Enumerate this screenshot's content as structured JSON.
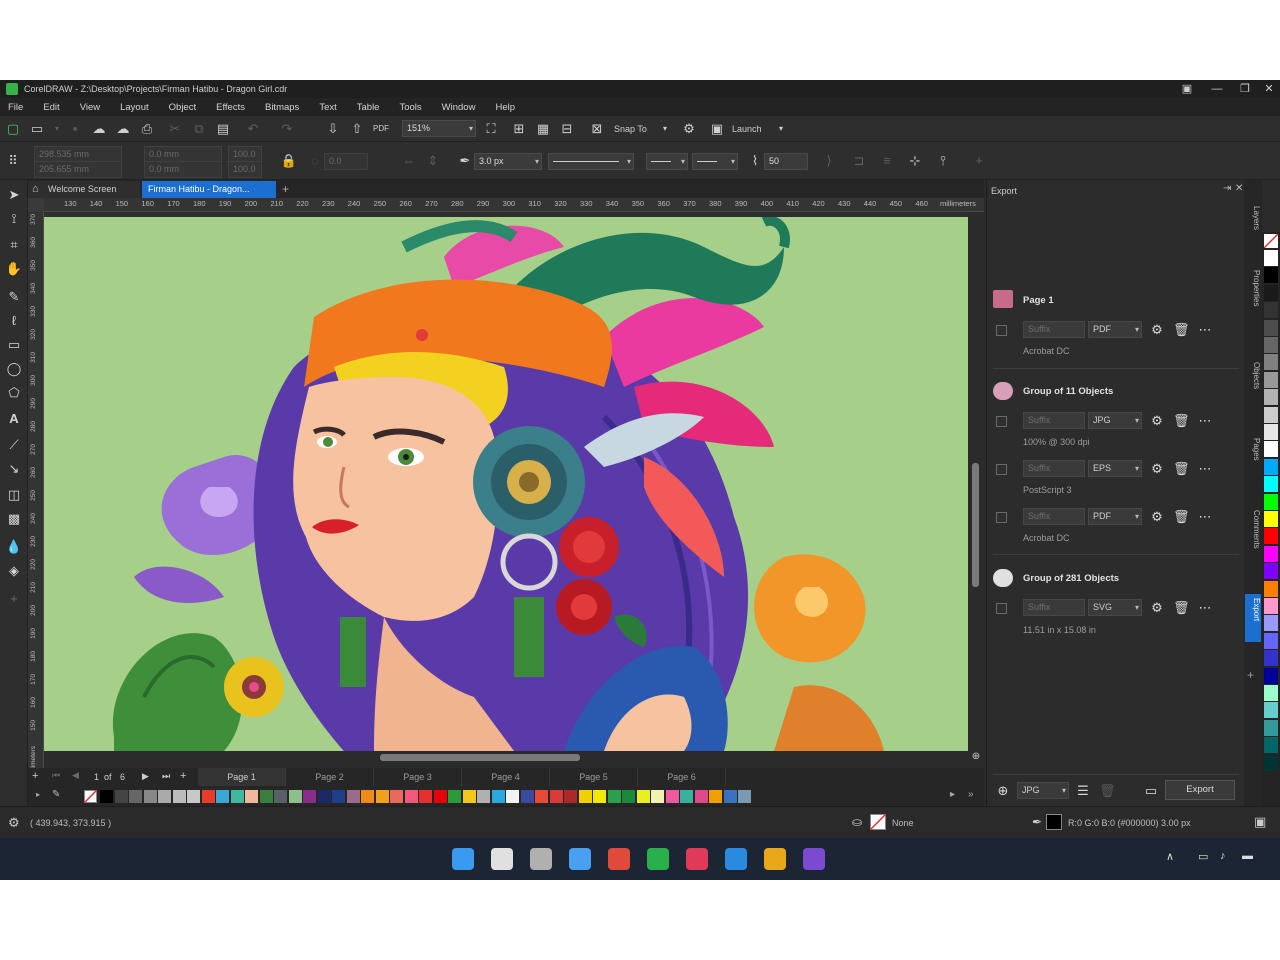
{
  "window": {
    "title": "CorelDRAW - Z:\\Desktop\\Projects\\Firman Hatibu - Dragon Girl.cdr",
    "min_icon": "minimize-icon",
    "max_icon": "restore-icon",
    "close_icon": "close-icon"
  },
  "menu": [
    "File",
    "Edit",
    "View",
    "Layout",
    "Object",
    "Effects",
    "Bitmaps",
    "Text",
    "Table",
    "Tools",
    "Window",
    "Help"
  ],
  "toolbar": {
    "zoom": "151%",
    "snap_to": "Snap To",
    "launch": "Launch"
  },
  "property_bar": {
    "x": "298.535 mm",
    "y": "205.655 mm",
    "w": "0.0 mm",
    "h": "0.0 mm",
    "scale_x": "100.0",
    "scale_y": "100.0",
    "angle": "0.0",
    "angle_pct": "50",
    "outline_width": "3.0 px",
    "smoothing": "50"
  },
  "doc_tabs": {
    "welcome": "Welcome Screen",
    "document": "Firman Hatibu - Dragon..."
  },
  "ruler": {
    "ticks": [
      "130",
      "140",
      "150",
      "160",
      "170",
      "180",
      "190",
      "200",
      "210",
      "220",
      "230",
      "240",
      "250",
      "260",
      "270",
      "280",
      "290",
      "300",
      "310",
      "320",
      "330",
      "340",
      "350",
      "360",
      "370",
      "380",
      "390",
      "400",
      "410",
      "420",
      "430",
      "440",
      "450",
      "460"
    ],
    "unit": "millimeters",
    "vertical_unit": "millimeters",
    "vticks": [
      "370",
      "360",
      "350",
      "340",
      "330",
      "320",
      "310",
      "300",
      "290",
      "280",
      "270",
      "260",
      "250",
      "240",
      "230",
      "220",
      "210",
      "200",
      "190",
      "180",
      "170",
      "160",
      "150"
    ]
  },
  "pages": {
    "current": "1",
    "of_label": "of",
    "total": "6",
    "tabs": [
      "Page 1",
      "Page 2",
      "Page 3",
      "Page 4",
      "Page 5",
      "Page 6"
    ]
  },
  "palette_colors": [
    "#000000",
    "#444444",
    "#666666",
    "#888888",
    "#aaaaaa",
    "#bcbcbc",
    "#c8c8c8",
    "#e63c2e",
    "#3aa7d6",
    "#3fb8a0",
    "#f2b89a",
    "#3a7f3d",
    "#586068",
    "#8fbf8a",
    "#8a2d8a",
    "#1b2a66",
    "#1e3f8a",
    "#9a6b8a",
    "#f28a1a",
    "#f2a01a",
    "#e86a5a",
    "#f25a7a",
    "#e63030",
    "#e6000a",
    "#2a9a3a",
    "#f2c81a",
    "#b0b0b0",
    "#2aa8e0",
    "#f2f2f2",
    "#3a4aa0",
    "#e84a3a",
    "#d83a3a",
    "#aa2a2a",
    "#f0d000",
    "#f2e800",
    "#2aa04a",
    "#1a8a3a",
    "#e8f020",
    "#f2f2b0",
    "#f25aa0",
    "#3ab0a0",
    "#e04a8a",
    "#f2a000",
    "#3a70c0",
    "#7a9ab0"
  ],
  "right_palette": [
    "#ffffff",
    "#000000",
    "#1a1a1a",
    "#333333",
    "#4d4d4d",
    "#666666",
    "#808080",
    "#999999",
    "#b3b3b3",
    "#cccccc",
    "#e6e6e6",
    "#ffffff",
    "#00aaff",
    "#00ffff",
    "#00ff00",
    "#ffff00",
    "#ff0000",
    "#ff00ff",
    "#8000ff",
    "#ff8000",
    "#ff99cc",
    "#9999ff",
    "#6666ff",
    "#3333cc",
    "#000099",
    "#99ffcc",
    "#66cccc",
    "#339999",
    "#006666",
    "#003333"
  ],
  "docker": {
    "title": "Export",
    "groups": [
      {
        "name": "Page 1",
        "rows": [
          {
            "suffix": "Suffix",
            "format": "PDF",
            "detail": "Acrobat DC"
          }
        ]
      },
      {
        "name": "Group of 11 Objects",
        "rows": [
          {
            "suffix": "Suffix",
            "format": "JPG",
            "detail": "100% @ 300 dpi"
          },
          {
            "suffix": "Suffix",
            "format": "EPS",
            "detail": "PostScript 3"
          },
          {
            "suffix": "Suffix",
            "format": "PDF",
            "detail": "Acrobat DC"
          }
        ]
      },
      {
        "name": "Group of 281 Objects",
        "rows": [
          {
            "suffix": "Suffix",
            "format": "SVG",
            "detail": "11.51 in x 15.08 in"
          }
        ]
      }
    ],
    "footer_format": "JPG",
    "export_button": "Export"
  },
  "side_tabs": [
    "Layers",
    "Properties",
    "Objects",
    "Pages",
    "Comments",
    "Export"
  ],
  "status": {
    "coords": "( 439.943, 373.915 )",
    "fill": "None",
    "outline": "R:0 G:0 B:0 (#000000)  3.00 px"
  },
  "taskbar_icons": [
    {
      "name": "start-icon",
      "color": "#3a9af0"
    },
    {
      "name": "search-icon",
      "color": "#e0e0e0"
    },
    {
      "name": "task-view-icon",
      "color": "#b0b0b0"
    },
    {
      "name": "widgets-icon",
      "color": "#4aa0f0"
    },
    {
      "name": "store-icon",
      "color": "#e04a3a"
    },
    {
      "name": "coreldraw-icon",
      "color": "#2ab04a"
    },
    {
      "name": "photo-paint-icon",
      "color": "#e03a5a"
    },
    {
      "name": "font-manager-icon",
      "color": "#2a8ae0"
    },
    {
      "name": "capture-icon",
      "color": "#e8a81a"
    },
    {
      "name": "vector-icon",
      "color": "#7a4ad0"
    }
  ]
}
